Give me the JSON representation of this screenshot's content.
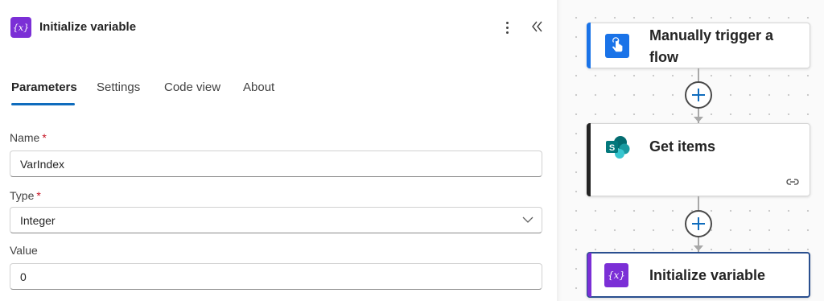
{
  "panel": {
    "title": "Initialize variable",
    "icon": "variable-icon",
    "tabs": [
      {
        "label": "Parameters",
        "active": true
      },
      {
        "label": "Settings",
        "active": false
      },
      {
        "label": "Code view",
        "active": false
      },
      {
        "label": "About",
        "active": false
      }
    ],
    "fields": {
      "name": {
        "label": "Name",
        "required": "*",
        "value": "VarIndex"
      },
      "type": {
        "label": "Type",
        "required": "*",
        "value": "Integer"
      },
      "value": {
        "label": "Value",
        "value": "0"
      }
    }
  },
  "flow": {
    "steps": [
      {
        "title_line1": "Manually trigger a",
        "title_line2": "flow",
        "icon": "touch-trigger-icon",
        "accent": "#1a73e8"
      },
      {
        "title": "Get items",
        "icon": "sharepoint-icon",
        "accent": "#242424"
      },
      {
        "title": "Initialize variable",
        "icon": "variable-icon",
        "accent": "#7b2fd6"
      }
    ]
  },
  "colors": {
    "brand_purple": "#7b2fd6",
    "accent_blue": "#0f6cbd",
    "required_red": "#c50f1f"
  }
}
